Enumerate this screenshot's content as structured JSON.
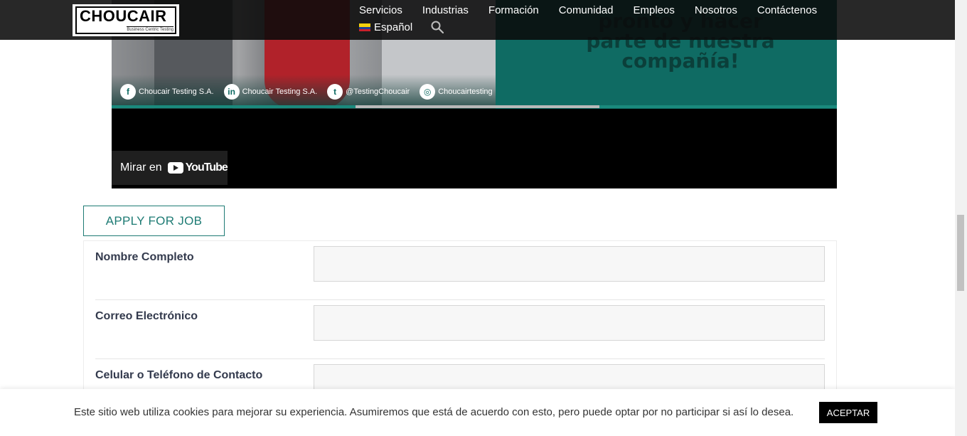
{
  "header": {
    "logo_text": "CHOUCAIR",
    "logo_tagline": "Business Centric Testing",
    "nav": [
      "Servicios",
      "Industrias",
      "Formación",
      "Comunidad",
      "Empleos",
      "Nosotros",
      "Contáctenos"
    ],
    "language": "Español",
    "search_icon": "search-icon"
  },
  "video": {
    "headline": "pronto y hacer parte de nuestra compañía!",
    "socials": [
      {
        "icon": "facebook-icon",
        "glyph": "f",
        "label": "Choucair Testing S.A."
      },
      {
        "icon": "linkedin-icon",
        "glyph": "in",
        "label": "Choucair Testing S.A."
      },
      {
        "icon": "twitter-icon",
        "glyph": "t",
        "label": "@TestingChoucair"
      },
      {
        "icon": "instagram-icon",
        "glyph": "◎",
        "label": "Choucairtesting"
      }
    ],
    "watch_label": "Mirar en",
    "youtube_label": "YouTube",
    "progress": 0.336
  },
  "form": {
    "tab_label": "APPLY FOR JOB",
    "fields": [
      {
        "label": "Nombre Completo",
        "value": ""
      },
      {
        "label": "Correo Electrónico",
        "value": ""
      },
      {
        "label": "Celular o Teléfono de Contacto",
        "value": ""
      }
    ]
  },
  "cookie": {
    "text": "Este sitio web utiliza cookies para mejorar su experiencia. Asumiremos que está de acuerdo con esto, pero puede optar por no participar si así lo desea.",
    "button": "ACEPTAR"
  },
  "colors": {
    "accent": "#1e7b74",
    "header_bg": "#0a0a0a"
  }
}
